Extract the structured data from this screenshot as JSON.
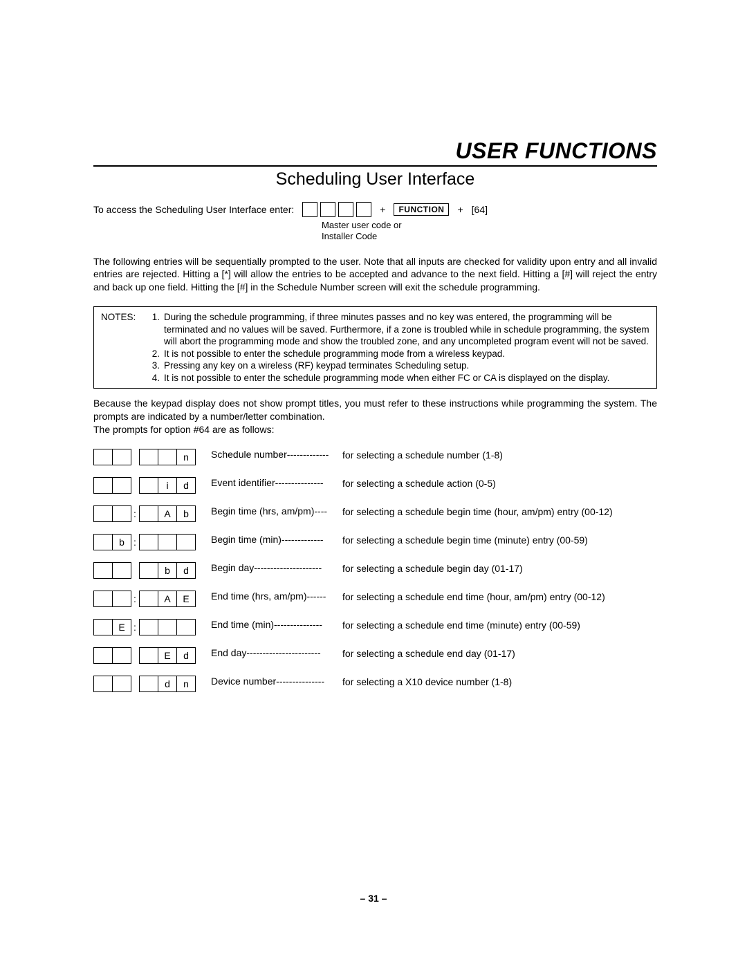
{
  "section_title": "USER FUNCTIONS",
  "subtitle": "Scheduling User Interface",
  "access_line": "To access the Scheduling User Interface enter:",
  "function_key": "FUNCTION",
  "code64": "[64]",
  "code_sub_line1": "Master user code or",
  "code_sub_line2": "Installer Code",
  "paragraph1": "The following entries will be sequentially prompted to the user. Note that all inputs are checked for validity upon entry and all invalid entries are rejected. Hitting a [*] will allow the entries to be accepted and advance to the next field. Hitting a [#] will reject the entry and back up one field. Hitting the [#] in the  Schedule Number  screen will exit the schedule programming.",
  "notes_label": "NOTES:",
  "notes": [
    {
      "n": "1.",
      "t": "During the schedule programming, if three minutes passes and no key was entered, the programming will be terminated and no values will be saved. Furthermore, if a zone is troubled while in schedule programming, the system will abort the programming mode and show the troubled zone, and any uncompleted program event will not be saved."
    },
    {
      "n": "2.",
      "t": "It is not possible to enter the schedule programming mode from a wireless keypad."
    },
    {
      "n": "3.",
      "t": "Pressing any key on a wireless (RF) keypad terminates Scheduling setup."
    },
    {
      "n": "4.",
      "t": "It is not possible to enter the schedule programming mode when either FC or CA is displayed on the display."
    }
  ],
  "intro2a": "Because the keypad display does not show prompt titles, you must refer to these instructions while programming the system. The prompts are indicated by a number/letter combination.",
  "intro2b": "The prompts for option #64 are as follows:",
  "prompts": [
    {
      "cells": [
        "",
        "",
        "",
        "",
        "n"
      ],
      "sep_after": 2,
      "label": "Schedule number-------------",
      "desc": "for selecting a schedule number (1-8)"
    },
    {
      "cells": [
        "",
        "",
        "",
        "i",
        "d"
      ],
      "sep_after": 2,
      "label": "Event identifier---------------",
      "desc": "for selecting a schedule action (0-5)"
    },
    {
      "cells": [
        "",
        "",
        "",
        "A",
        "b"
      ],
      "sep_after": 2,
      "colon_after": 2,
      "label": "Begin time (hrs, am/pm)----",
      "desc": "for selecting a schedule begin time (hour, am/pm) entry (00-12)"
    },
    {
      "cells": [
        "",
        "b",
        "",
        "",
        ""
      ],
      "sep_after": 2,
      "colon_after": 2,
      "label": "Begin time (min)-------------",
      "desc": "for selecting a schedule begin time (minute) entry (00-59)"
    },
    {
      "cells": [
        "",
        "",
        "",
        "b",
        "d"
      ],
      "sep_after": 2,
      "label": "Begin day---------------------",
      "desc": "for selecting a schedule begin day (01-17)"
    },
    {
      "cells": [
        "",
        "",
        "",
        "A",
        "E"
      ],
      "sep_after": 2,
      "colon_after": 2,
      "label": "End time (hrs, am/pm)------",
      "desc": "for selecting a schedule end time (hour, am/pm) entry (00-12)"
    },
    {
      "cells": [
        "",
        "E",
        "",
        "",
        ""
      ],
      "sep_after": 2,
      "colon_after": 2,
      "label": "End time (min)---------------",
      "desc": "for selecting a schedule end time (minute) entry (00-59)"
    },
    {
      "cells": [
        "",
        "",
        "",
        "E",
        "d"
      ],
      "sep_after": 2,
      "label": "End day-----------------------",
      "desc": "for selecting a schedule end day (01-17)"
    },
    {
      "cells": [
        "",
        "",
        "",
        "d",
        "n"
      ],
      "sep_after": 2,
      "label": "Device number---------------",
      "desc": "for selecting a X10 device number (1-8)"
    }
  ],
  "page_number": "– 31 –"
}
